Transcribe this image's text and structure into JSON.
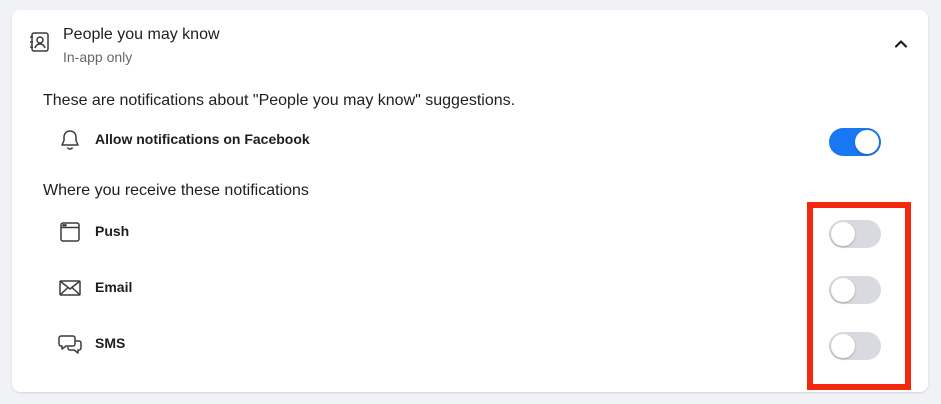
{
  "section": {
    "title": "People you may know",
    "subtitle": "In-app only",
    "icon": "contact-card-icon"
  },
  "description": "These are notifications about \"People you may know\" suggestions.",
  "allow": {
    "label": "Allow notifications on Facebook",
    "enabled": true,
    "icon": "bell-icon"
  },
  "where_title": "Where you receive these notifications",
  "channels": [
    {
      "label": "Push",
      "enabled": false,
      "icon": "browser-window-icon"
    },
    {
      "label": "Email",
      "enabled": false,
      "icon": "envelope-icon"
    },
    {
      "label": "SMS",
      "enabled": false,
      "icon": "chat-bubbles-icon"
    }
  ],
  "colors": {
    "accent": "#1877f2",
    "highlight": "#f5270e",
    "toggle_off": "#d8dadf"
  }
}
